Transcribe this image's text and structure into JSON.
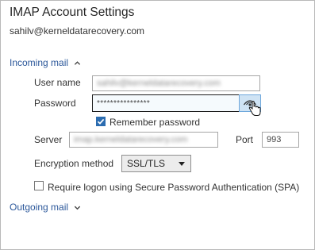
{
  "header": {
    "title": "IMAP Account Settings",
    "email": "sahilv@kerneldatarecovery.com"
  },
  "incoming": {
    "section_label": "Incoming mail",
    "expanded": true,
    "user_name_label": "User name",
    "user_name_value": "sahilv@kerneldatarecovery.com",
    "password_label": "Password",
    "password_value": "****************",
    "remember_label": "Remember password",
    "remember_checked": true,
    "server_label": "Server",
    "server_value": "imap.kerneldatarecovery.com",
    "port_label": "Port",
    "port_value": "993",
    "encryption_label": "Encryption method",
    "encryption_value": "SSL/TLS",
    "spa_label": "Require logon using Secure Password Authentication (SPA)",
    "spa_checked": false
  },
  "outgoing": {
    "section_label": "Outgoing mail",
    "expanded": false
  },
  "colors": {
    "section_link": "#2b579a",
    "checkbox_on": "#2b6cb0",
    "reveal_button_bg": "#cfe3f4"
  }
}
